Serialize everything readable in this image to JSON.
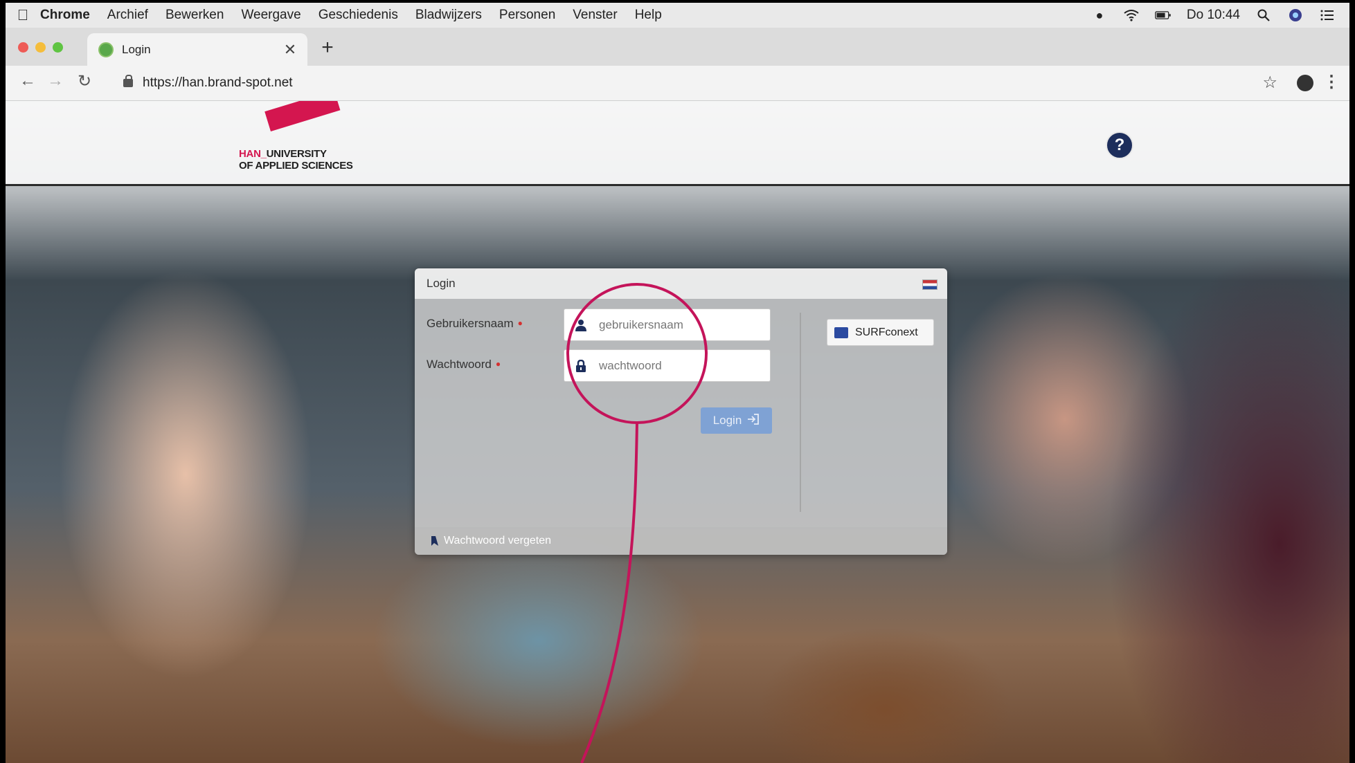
{
  "menubar": {
    "items": [
      "Chrome",
      "Archief",
      "Bewerken",
      "Weergave",
      "Geschiedenis",
      "Bladwijzers",
      "Personen",
      "Venster",
      "Help"
    ],
    "clock": "Do 10:44"
  },
  "browser": {
    "tab_title": "Login",
    "url": "https://han.brand-spot.net"
  },
  "page": {
    "logo_line1_prefix": "HAN_",
    "logo_line1_rest": "UNIVERSITY",
    "logo_line2": "OF APPLIED SCIENCES",
    "help_label": "?"
  },
  "login": {
    "title": "Login",
    "username_label": "Gebruikersnaam",
    "username_placeholder": "gebruikersnaam",
    "password_label": "Wachtwoord",
    "password_placeholder": "wachtwoord",
    "submit_label": "Login",
    "surfconext_label": "SURFconext",
    "forgot_label": "Wachtwoord vergeten"
  },
  "colors": {
    "brand": "#d4164f",
    "annotation": "#c4145a",
    "button": "#7fa2d4"
  }
}
